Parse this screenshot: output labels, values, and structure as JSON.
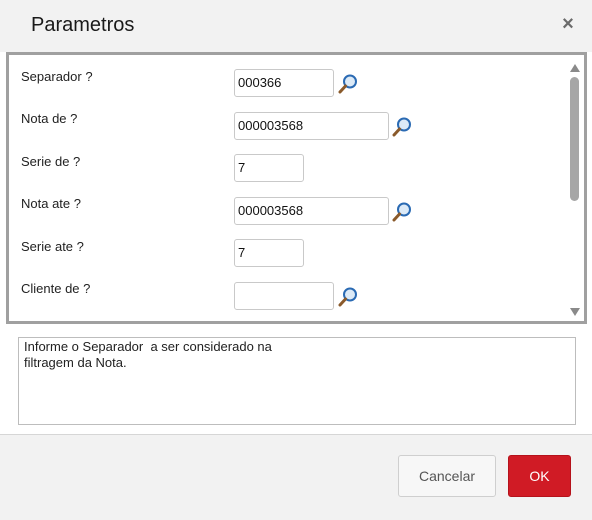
{
  "dialog": {
    "title": "Parametros",
    "close_icon": "close-icon"
  },
  "params": [
    {
      "label": "Separador ?",
      "value": "000366",
      "placeholder": "",
      "has_lookup": true
    },
    {
      "label": "Nota de ?",
      "value": "000003568",
      "placeholder": "",
      "has_lookup": true
    },
    {
      "label": "Serie de ?",
      "value": "7",
      "placeholder": "",
      "has_lookup": false
    },
    {
      "label": "Nota ate ?",
      "value": "000003568",
      "placeholder": "",
      "has_lookup": true
    },
    {
      "label": "Serie ate ?",
      "value": "7",
      "placeholder": "",
      "has_lookup": false
    },
    {
      "label": "Cliente de ?",
      "value": "",
      "placeholder": "",
      "has_lookup": true
    }
  ],
  "help": {
    "lines": [
      "Informe o Separador  a ser considerado na",
      "filtragem da Nota."
    ]
  },
  "footer": {
    "cancel_label": "Cancelar",
    "ok_label": "OK"
  },
  "colors": {
    "accent": "#d01b25",
    "lookup_icon": "#2a6ab3"
  }
}
